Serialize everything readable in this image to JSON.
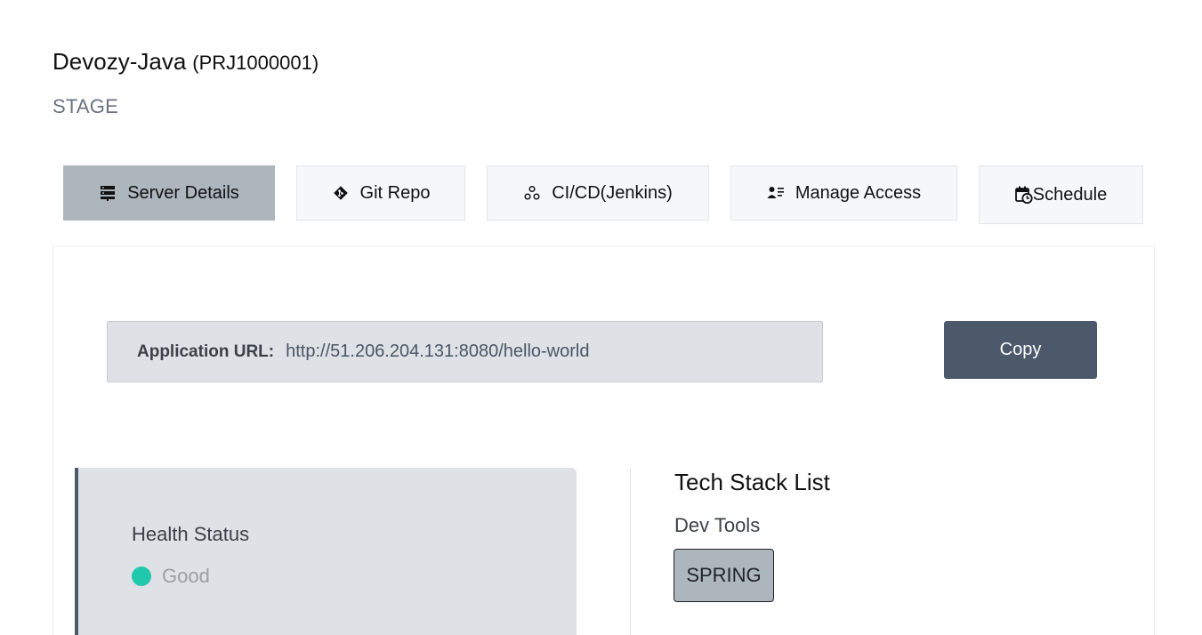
{
  "project": {
    "name": "Devozy-Java",
    "code": "(PRJ1000001)",
    "environment": "STAGE"
  },
  "tabs": [
    {
      "label": "Server Details",
      "icon": "server-icon",
      "active": true
    },
    {
      "label": "Git Repo",
      "icon": "git-icon",
      "active": false
    },
    {
      "label": "CI/CD(Jenkins)",
      "icon": "pipeline-icon",
      "active": false
    },
    {
      "label": "Manage Access",
      "icon": "user-list-icon",
      "active": false
    },
    {
      "label": "Schedule",
      "icon": "calendar-clock-icon",
      "active": false
    }
  ],
  "server_details": {
    "url_label": "Application URL:",
    "url_value": "http://51.206.204.131:8080/hello-world",
    "copy_label": "Copy"
  },
  "health": {
    "title": "Health Status",
    "status": "Good",
    "status_color": "#20c9ac"
  },
  "tech_stack": {
    "title": "Tech Stack List",
    "category": "Dev Tools",
    "items": [
      "SPRING"
    ]
  },
  "colors": {
    "active_tab": "#adb5bd",
    "copy_button": "#4b596b",
    "card_background": "#dee2e6"
  }
}
